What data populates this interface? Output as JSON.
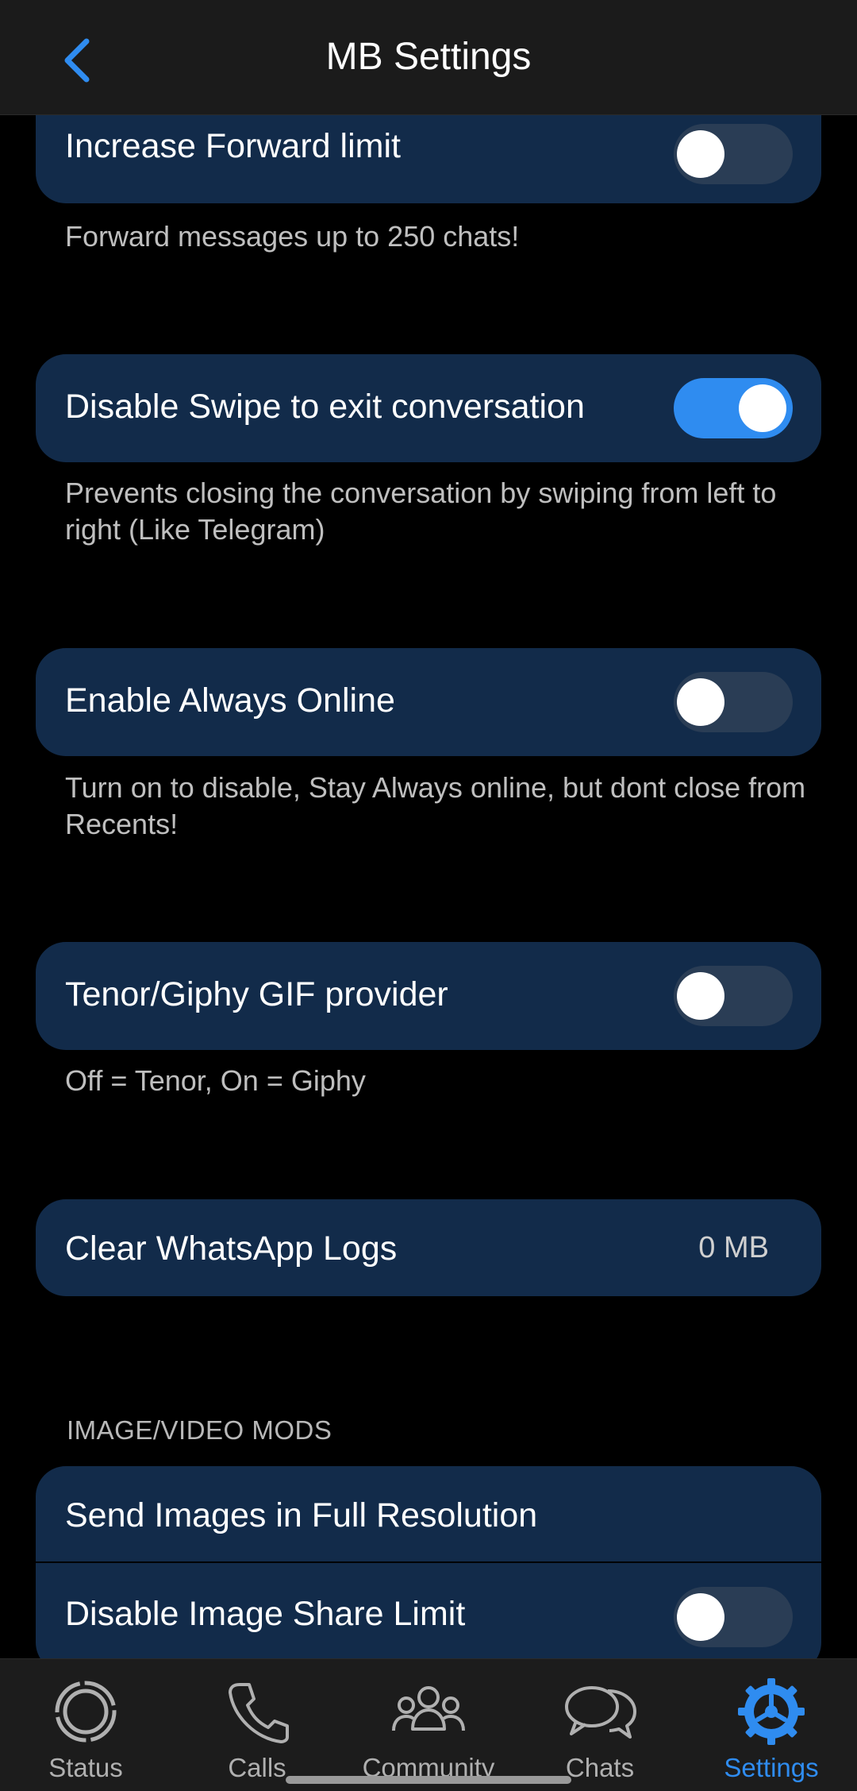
{
  "header": {
    "title": "MB Settings"
  },
  "settings": [
    {
      "label": "Increase Forward limit",
      "toggle": "off",
      "desc": "Forward messages up to 250 chats!"
    },
    {
      "label": "Disable Swipe to exit conversation",
      "toggle": "on",
      "desc": "Prevents closing the conversation by swiping from left to right (Like Telegram)"
    },
    {
      "label": "Enable Always Online",
      "toggle": "off",
      "desc": "Turn on to disable, Stay Always online, but dont close from Recents!"
    },
    {
      "label": "Tenor/Giphy GIF provider",
      "toggle": "off",
      "desc": "Off = Tenor, On = Giphy"
    }
  ],
  "clear_logs": {
    "label": "Clear WhatsApp Logs",
    "value": "0 MB"
  },
  "image_video": {
    "section_title": "IMAGE/VIDEO MODS",
    "items": [
      {
        "label": "Send Images in Full Resolution"
      },
      {
        "label": "Disable Image Share Limit",
        "toggle": "off"
      }
    ]
  },
  "bottom_nav": {
    "items": [
      {
        "label": "Status",
        "icon": "status-icon"
      },
      {
        "label": "Calls",
        "icon": "phone-icon"
      },
      {
        "label": "Community",
        "icon": "community-icon"
      },
      {
        "label": "Chats",
        "icon": "chats-icon"
      },
      {
        "label": "Settings",
        "icon": "settings-gear-icon",
        "active": true
      }
    ]
  },
  "colors": {
    "accent": "#2f8cf0",
    "card": "#122b4a",
    "background": "#000000"
  }
}
